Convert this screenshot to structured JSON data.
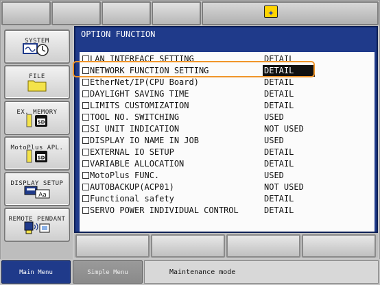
{
  "panel": {
    "title": "OPTION FUNCTION"
  },
  "sidebar": {
    "items": [
      {
        "label": "SYSTEM",
        "icon": "system-clock-icon"
      },
      {
        "label": "FILE",
        "icon": "folder-icon"
      },
      {
        "label": "EX. MEMORY",
        "icon": "sd-card-icon"
      },
      {
        "label": "MotoPlus APL.",
        "icon": "sd-card-icon"
      },
      {
        "label": "DISPLAY SETUP",
        "icon": "display-font-icon"
      },
      {
        "label": "REMOTE PENDANT",
        "icon": "pendant-icon"
      }
    ]
  },
  "options": [
    {
      "name": "LAN INTERFACE SETTING",
      "value": "DETAIL"
    },
    {
      "name": "NETWORK FUNCTION SETTING",
      "value": "DETAIL"
    },
    {
      "name": "EtherNet/IP(CPU Board)",
      "value": "DETAIL"
    },
    {
      "name": "DAYLIGHT SAVING TIME",
      "value": "DETAIL"
    },
    {
      "name": "LIMITS CUSTOMIZATION",
      "value": "DETAIL"
    },
    {
      "name": "TOOL NO. SWITCHING",
      "value": "USED"
    },
    {
      "name": "SI UNIT INDICATION",
      "value": "NOT USED"
    },
    {
      "name": "DISPLAY IO NAME IN JOB",
      "value": "USED"
    },
    {
      "name": "EXTERNAL IO SETUP",
      "value": "DETAIL"
    },
    {
      "name": "VARIABLE ALLOCATION",
      "value": "DETAIL"
    },
    {
      "name": "MotoPlus FUNC.",
      "value": "USED"
    },
    {
      "name": "AUTOBACKUP(ACP01)",
      "value": "NOT USED"
    },
    {
      "name": "Functional safety",
      "value": "DETAIL"
    },
    {
      "name": "SERVO POWER INDIVIDUAL CONTROL",
      "value": "DETAIL"
    }
  ],
  "footer": {
    "main_menu": "Main Menu",
    "simple_menu": "Simple Menu",
    "status": "Maintenance mode"
  },
  "colors": {
    "panel_blue": "#1f3a8a",
    "highlight": "#f0952a"
  }
}
